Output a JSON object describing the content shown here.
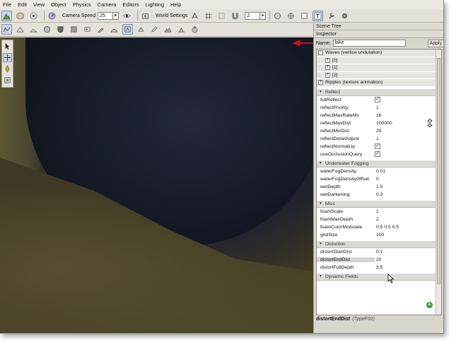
{
  "menu": [
    "File",
    "Edit",
    "View",
    "Object",
    "Physics",
    "Camera",
    "Editors",
    "Lighting",
    "Help"
  ],
  "toolbar": {
    "camera_speed_label": "Camera Speed",
    "camera_speed_value": "25",
    "world_settings_label": "World Settings",
    "grid_value": "2"
  },
  "panel": {
    "scene_tree_title": "Scene Tree",
    "inspector_title": "Inspector",
    "name_label": "Name:",
    "name_value": "lake",
    "apply_label": "Apply"
  },
  "inspector": {
    "waves_label": "Waves (vertice undulation)",
    "waves_items": [
      "[0]",
      "[1]",
      "[2]"
    ],
    "ripples_label": "Ripples (texture animation)",
    "sections": [
      {
        "title": "Reflect",
        "fields": [
          {
            "label": "fullReflect",
            "value": "",
            "checked": true
          },
          {
            "label": "reflectPriority",
            "value": "1"
          },
          {
            "label": "reflectMaxRateMs",
            "value": "16"
          },
          {
            "label": "reflectMaxDist",
            "value": "100000"
          },
          {
            "label": "reflectMinDist",
            "value": "25"
          },
          {
            "label": "reflectDetailAdjust",
            "value": "1"
          },
          {
            "label": "reflectNormalUp",
            "value": "",
            "checked": true
          },
          {
            "label": "useOcclusionQuery",
            "value": "",
            "checked": true
          }
        ]
      },
      {
        "title": "Underwater Fogging",
        "fields": [
          {
            "label": "waterFogDensity",
            "value": "0.01"
          },
          {
            "label": "waterFogDensityOffset",
            "value": "0"
          },
          {
            "label": "wetDepth",
            "value": "1.5"
          },
          {
            "label": "wetDarkening",
            "value": "0.3"
          }
        ]
      },
      {
        "title": "Misc",
        "fields": [
          {
            "label": "foamScale",
            "value": "1"
          },
          {
            "label": "foamMaxDepth",
            "value": "2"
          },
          {
            "label": "foamColorModulate",
            "value": "0.5 0.5 0.5"
          },
          {
            "label": "gridSize",
            "value": "100"
          }
        ]
      },
      {
        "title": "Distortion",
        "fields": [
          {
            "label": "distortStartDist",
            "value": "0.1"
          },
          {
            "label": "distortEndDist",
            "value": "20",
            "selected": true
          },
          {
            "label": "distortFullDepth",
            "value": "3.5"
          }
        ]
      },
      {
        "title": "Dynamic Fields",
        "fields": []
      }
    ]
  },
  "status": {
    "field_name": "distortEndDist",
    "field_type": "(TypeF32)"
  },
  "colors": {
    "selection": "#d4d4d4",
    "toolbar_active": "#c9d7e6",
    "add_button": "#38a038",
    "annotation_arrow": "#cc1111"
  }
}
